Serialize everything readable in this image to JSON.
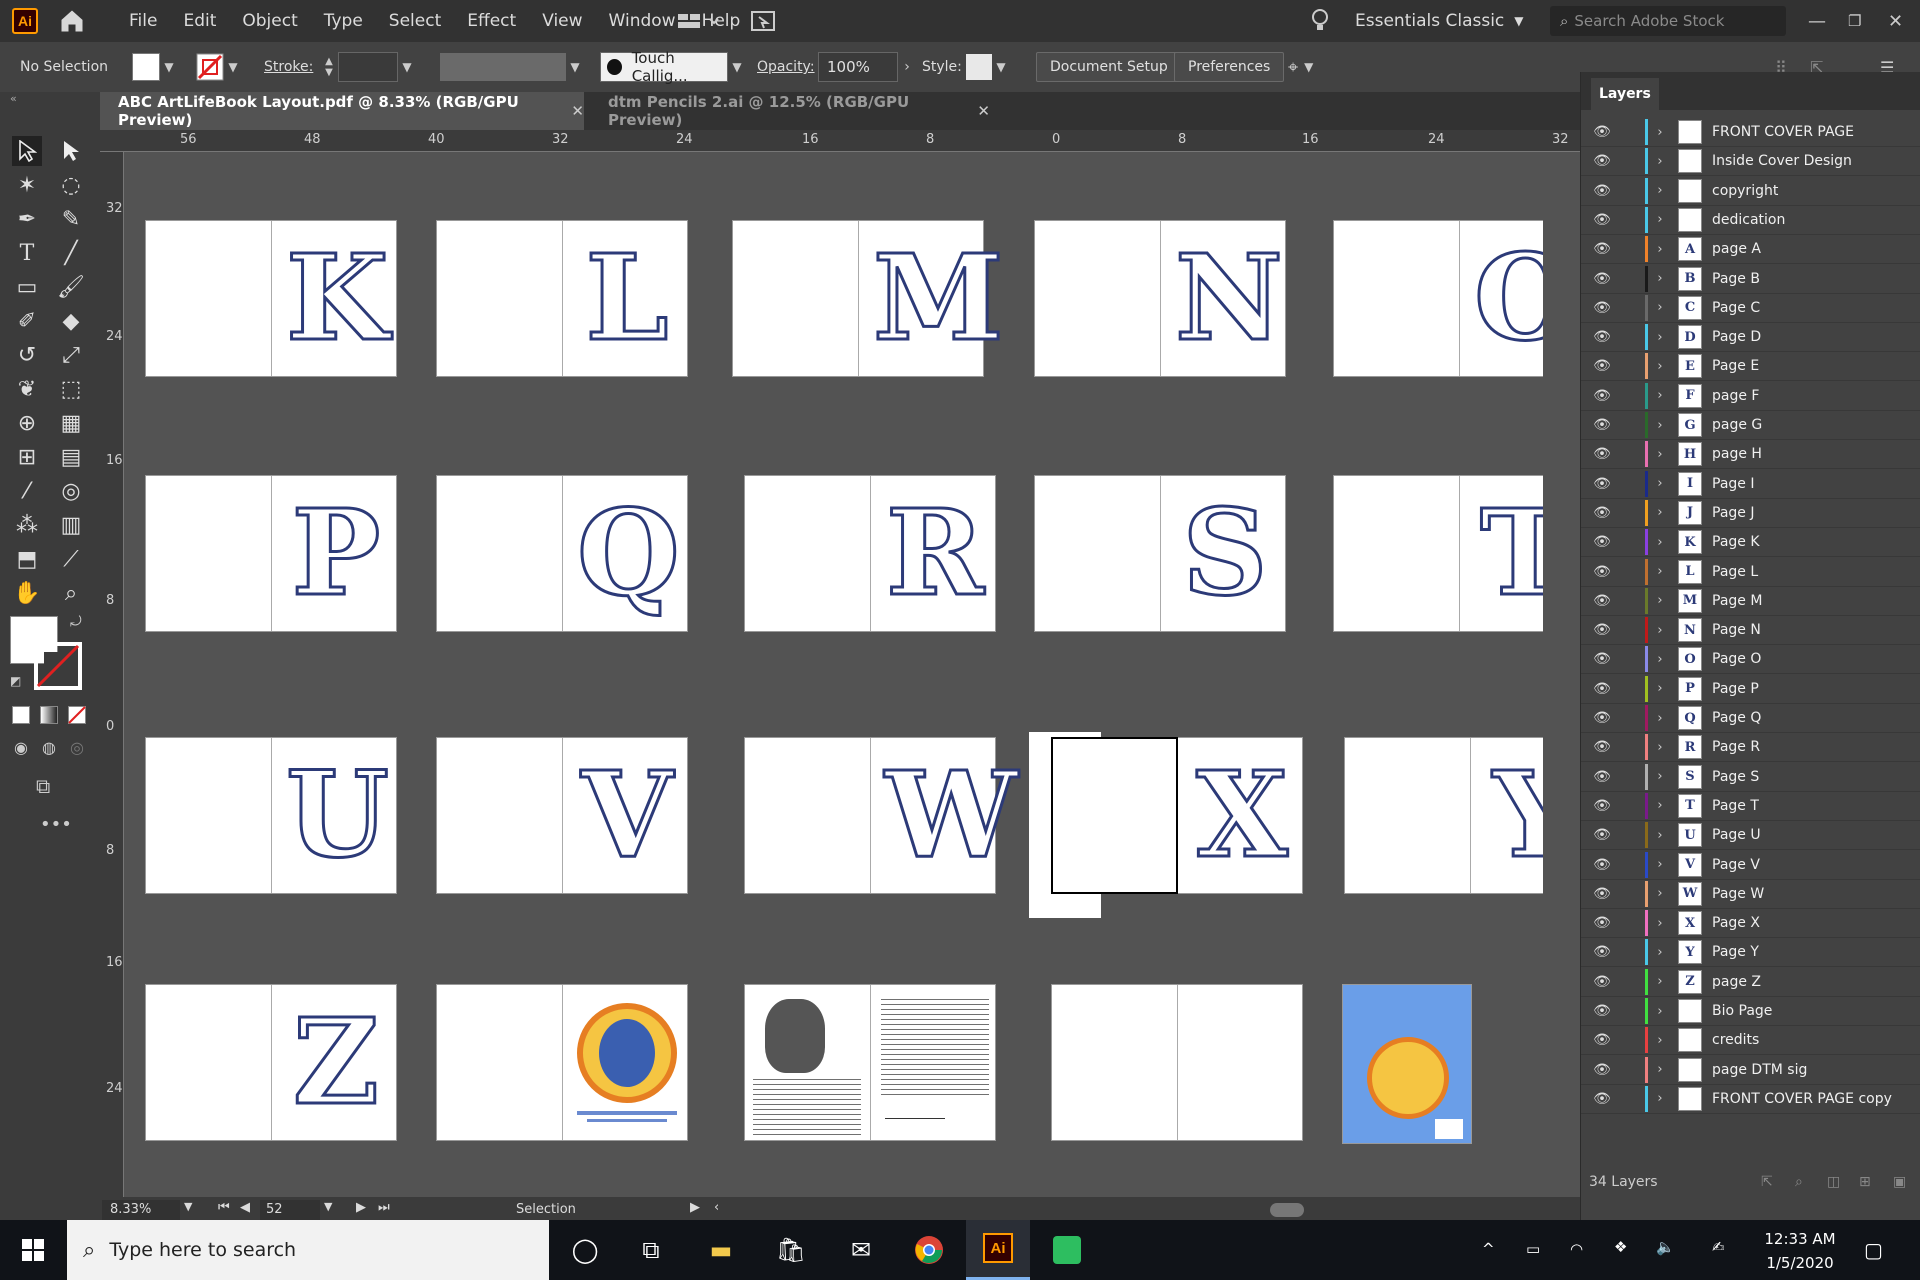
{
  "app": {
    "logo": "Ai",
    "menus": [
      "File",
      "Edit",
      "Object",
      "Type",
      "Select",
      "Effect",
      "View",
      "Window",
      "Help"
    ],
    "workspace": "Essentials Classic",
    "stock_placeholder": "Search Adobe Stock"
  },
  "control": {
    "selection": "No Selection",
    "stroke_label": "Stroke:",
    "brush": "Touch Callig...",
    "opacity_label": "Opacity:",
    "opacity_value": "100%",
    "style_label": "Style:",
    "document_setup": "Document Setup",
    "preferences": "Preferences"
  },
  "tabs": [
    {
      "label": "ABC ArtLifeBook Layout.pdf @ 8.33% (RGB/GPU Preview)",
      "active": true
    },
    {
      "label": "dtm Pencils 2.ai @ 12.5% (RGB/GPU Preview)",
      "active": false
    }
  ],
  "ruler": {
    "h": [
      "56",
      "48",
      "40",
      "32",
      "24",
      "16",
      "8",
      "0",
      "8",
      "16",
      "24",
      "32"
    ],
    "v": [
      "32",
      "24",
      "16",
      "8",
      "0",
      "8",
      "16",
      "24"
    ]
  },
  "spreads": [
    {
      "letter": "K"
    },
    {
      "letter": "L"
    },
    {
      "letter": "M"
    },
    {
      "letter": "N"
    },
    {
      "letter": "O"
    },
    {
      "letter": "P"
    },
    {
      "letter": "Q"
    },
    {
      "letter": "R"
    },
    {
      "letter": "S"
    },
    {
      "letter": "T"
    },
    {
      "letter": "U"
    },
    {
      "letter": "V"
    },
    {
      "letter": "W"
    },
    {
      "letter": "X"
    },
    {
      "letter": "Y"
    },
    {
      "letter": "Z"
    },
    {
      "letter": ""
    },
    {
      "letter": ""
    },
    {
      "letter": ""
    },
    {
      "letter": ""
    }
  ],
  "status": {
    "zoom": "8.33%",
    "artboard": "52",
    "tool": "Selection"
  },
  "layers": {
    "title": "Layers",
    "count": "34 Layers",
    "items": [
      {
        "name": "FRONT COVER PAGE",
        "color": "#4ac8e8",
        "thumb": ""
      },
      {
        "name": "Inside Cover Design",
        "color": "#4ac8e8",
        "thumb": ""
      },
      {
        "name": "copyright",
        "color": "#4ac8e8",
        "thumb": ""
      },
      {
        "name": "dedication",
        "color": "#4ac8e8",
        "thumb": ""
      },
      {
        "name": "page A",
        "color": "#f0822a",
        "thumb": "A"
      },
      {
        "name": "Page B",
        "color": "#1a1a1a",
        "thumb": "B"
      },
      {
        "name": "Page C",
        "color": "#6a6a6a",
        "thumb": "C"
      },
      {
        "name": "Page D",
        "color": "#4ac8e8",
        "thumb": "D"
      },
      {
        "name": "Page E",
        "color": "#e8a070",
        "thumb": "E"
      },
      {
        "name": "page F",
        "color": "#2a9a8a",
        "thumb": "F"
      },
      {
        "name": "page G",
        "color": "#2a6a2a",
        "thumb": "G"
      },
      {
        "name": "page H",
        "color": "#e870b0",
        "thumb": "H"
      },
      {
        "name": "Page I",
        "color": "#1a2a8a",
        "thumb": "I"
      },
      {
        "name": "Page J",
        "color": "#f0a020",
        "thumb": "J"
      },
      {
        "name": "Page K",
        "color": "#8a40e0",
        "thumb": "K"
      },
      {
        "name": "Page L",
        "color": "#c07030",
        "thumb": "L"
      },
      {
        "name": "Page M",
        "color": "#6a7a2a",
        "thumb": "M"
      },
      {
        "name": "Page N",
        "color": "#c01a1a",
        "thumb": "N"
      },
      {
        "name": "Page O",
        "color": "#8a8ae8",
        "thumb": "O"
      },
      {
        "name": "Page P",
        "color": "#a0c020",
        "thumb": "P"
      },
      {
        "name": "Page Q",
        "color": "#a01a60",
        "thumb": "Q"
      },
      {
        "name": "Page R",
        "color": "#f08080",
        "thumb": "R"
      },
      {
        "name": "Page S",
        "color": "#b0b0b0",
        "thumb": "S"
      },
      {
        "name": "Page T",
        "color": "#7a1a8a",
        "thumb": "T"
      },
      {
        "name": "Page U",
        "color": "#8a6a1a",
        "thumb": "U"
      },
      {
        "name": "Page V",
        "color": "#2a4ac8",
        "thumb": "V"
      },
      {
        "name": "Page W",
        "color": "#e8a070",
        "thumb": "W"
      },
      {
        "name": "Page X",
        "color": "#f070c0",
        "thumb": "X"
      },
      {
        "name": "Page Y",
        "color": "#4ac8e8",
        "thumb": "Y"
      },
      {
        "name": "page Z",
        "color": "#40e040",
        "thumb": "Z"
      },
      {
        "name": "Bio Page",
        "color": "#40e040",
        "thumb": ""
      },
      {
        "name": "credits",
        "color": "#e84040",
        "thumb": ""
      },
      {
        "name": "page DTM sig",
        "color": "#f08080",
        "thumb": ""
      },
      {
        "name": "FRONT COVER PAGE copy",
        "color": "#4ac8e8",
        "thumb": ""
      }
    ]
  },
  "taskbar": {
    "search_placeholder": "Type here to search",
    "time": "12:33 AM",
    "date": "1/5/2020"
  }
}
